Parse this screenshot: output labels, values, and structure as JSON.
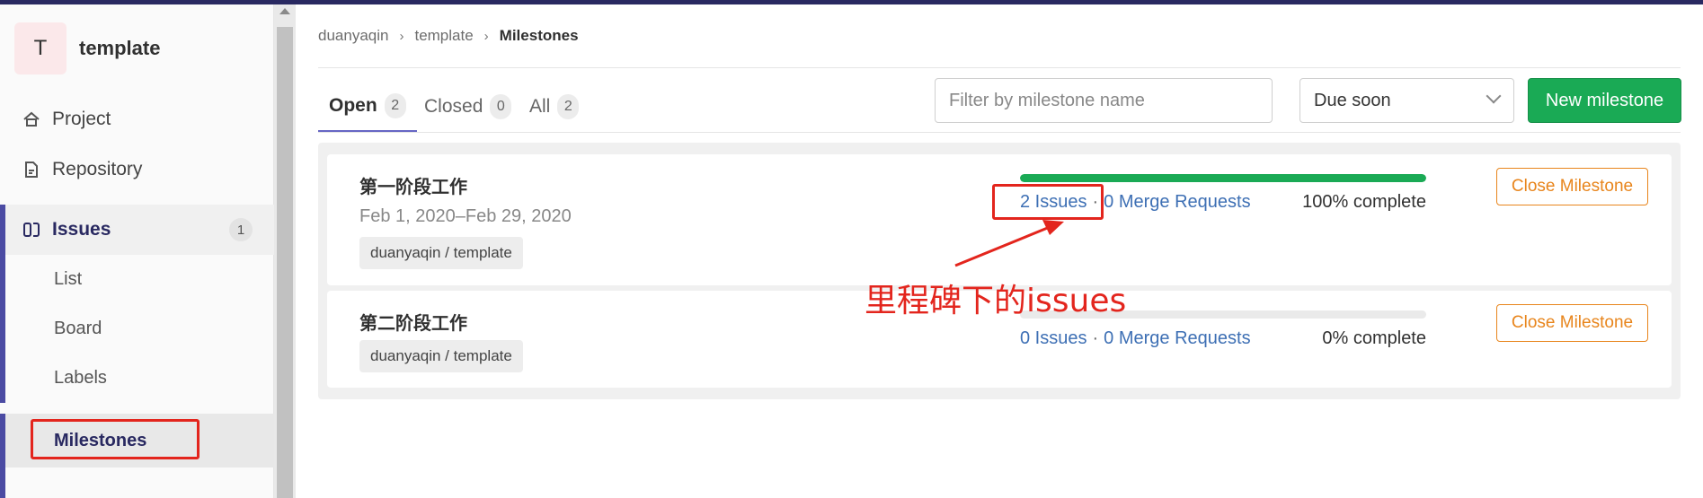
{
  "sidebar": {
    "project_avatar": "T",
    "project_name": "template",
    "nav": [
      {
        "label": "Project",
        "icon": "home-icon"
      },
      {
        "label": "Repository",
        "icon": "document-icon"
      },
      {
        "label": "Issues",
        "icon": "issues-icon",
        "count": "1"
      }
    ],
    "issues_sub": [
      {
        "label": "List"
      },
      {
        "label": "Board"
      },
      {
        "label": "Labels"
      },
      {
        "label": "Milestones"
      }
    ]
  },
  "breadcrumb": {
    "items": [
      "duanyaqin",
      "template",
      "Milestones"
    ]
  },
  "tabs": [
    {
      "label": "Open",
      "count": "2"
    },
    {
      "label": "Closed",
      "count": "0"
    },
    {
      "label": "All",
      "count": "2"
    }
  ],
  "filter": {
    "placeholder": "Filter by milestone name"
  },
  "sort": {
    "selected": "Due soon"
  },
  "new_button": "New milestone",
  "milestones": [
    {
      "title": "第一阶段工作",
      "dates": "Feb 1, 2020–Feb 29, 2020",
      "path": "duanyaqin / template",
      "issues": "2 Issues",
      "separator": "·",
      "merge_requests": "0 Merge Requests",
      "percent_text": "100% complete",
      "progress_fraction": 1.0,
      "close_label": "Close Milestone"
    },
    {
      "title": "第二阶段工作",
      "dates": "",
      "path": "duanyaqin / template",
      "issues": "0 Issues",
      "separator": "·",
      "merge_requests": "0 Merge Requests",
      "percent_text": "0% complete",
      "progress_fraction": 0.0,
      "close_label": "Close Milestone"
    }
  ],
  "annotation": {
    "text": "里程碑下的issues"
  },
  "colors": {
    "accent": "#4b4ba3",
    "success": "#1aaa55",
    "warning": "#e8851c",
    "annotation": "#e3251d",
    "link": "#3d6fb4"
  }
}
